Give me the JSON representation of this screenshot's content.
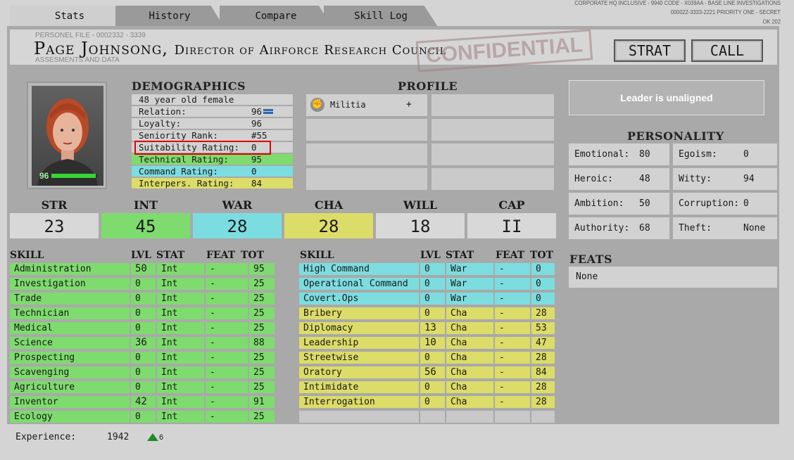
{
  "tabs": [
    "Stats",
    "History",
    "Compare",
    "Skill Log"
  ],
  "header_meta": [
    "CORPORATE HQ INCLUSIVE - 9940 CODE - X039AA - BASE LINE INVESTIGATIONS",
    "000022-3333-2221 PRIORITY ONE - SECRET",
    "OK 202"
  ],
  "personnel_file": "PERSONEL FILE  -  0002332 - 3339",
  "assesments": "ASSESMENTS AND DATA",
  "name": "Page Johnsong,",
  "title": "Director of Airforce Research Council",
  "stamp": "CONFIDENTIAL",
  "buttons": {
    "strat": "STRAT",
    "call": "CALL"
  },
  "portrait": {
    "health": "96",
    "health_fraction": 0.96
  },
  "demographics": {
    "title": "DEMOGRAPHICS",
    "desc": "48 year old female",
    "rows": [
      {
        "label": "Relation:",
        "value": "96"
      },
      {
        "label": "Loyalty:",
        "value": "96"
      },
      {
        "label": "Seniority Rank:",
        "value": "#55"
      },
      {
        "label": "Suitability Rating:",
        "value": "0"
      },
      {
        "label": "Technical Rating:",
        "value": "95"
      },
      {
        "label": "Command Rating:",
        "value": "0"
      },
      {
        "label": "Interpers. Rating:",
        "value": "84"
      }
    ]
  },
  "profile": {
    "title": "PROFILE",
    "item": "Militia",
    "add": "+"
  },
  "alignment": "Leader is unaligned",
  "personality": {
    "title": "PERSONALITY",
    "items": [
      {
        "label": "Emotional:",
        "value": "80"
      },
      {
        "label": "Egoism:",
        "value": "0"
      },
      {
        "label": "Heroic:",
        "value": "48"
      },
      {
        "label": "Witty:",
        "value": "94"
      },
      {
        "label": "Ambition:",
        "value": "50"
      },
      {
        "label": "Corruption:",
        "value": "0"
      },
      {
        "label": "Authority:",
        "value": "68"
      },
      {
        "label": "Theft:",
        "value": "None"
      }
    ]
  },
  "feats": {
    "title": "FEATS",
    "value": "None"
  },
  "stats": [
    {
      "label": "STR",
      "value": "23"
    },
    {
      "label": "INT",
      "value": "45"
    },
    {
      "label": "WAR",
      "value": "28"
    },
    {
      "label": "CHA",
      "value": "28"
    },
    {
      "label": "WILL",
      "value": "18"
    },
    {
      "label": "CAP",
      "value": "II"
    }
  ],
  "skill_headers": [
    "SKILL",
    "LVL",
    "STAT",
    "FEAT",
    "TOT"
  ],
  "skills_left": [
    [
      "Administration",
      "50",
      "Int",
      "-",
      "95"
    ],
    [
      "Investigation",
      "0",
      "Int",
      "-",
      "25"
    ],
    [
      "Trade",
      "0",
      "Int",
      "-",
      "25"
    ],
    [
      "Technician",
      "0",
      "Int",
      "-",
      "25"
    ],
    [
      "Medical",
      "0",
      "Int",
      "-",
      "25"
    ],
    [
      "Science",
      "36",
      "Int",
      "-",
      "88"
    ],
    [
      "Prospecting",
      "0",
      "Int",
      "-",
      "25"
    ],
    [
      "Scavenging",
      "0",
      "Int",
      "-",
      "25"
    ],
    [
      "Agriculture",
      "0",
      "Int",
      "-",
      "25"
    ],
    [
      "Inventor",
      "42",
      "Int",
      "-",
      "91"
    ],
    [
      "Ecology",
      "0",
      "Int",
      "-",
      "25"
    ]
  ],
  "skills_right": [
    [
      "High Command",
      "0",
      "War",
      "-",
      "0"
    ],
    [
      "Operational Command",
      "0",
      "War",
      "-",
      "0"
    ],
    [
      "Covert.Ops",
      "0",
      "War",
      "-",
      "0"
    ],
    [
      "Bribery",
      "0",
      "Cha",
      "-",
      "28"
    ],
    [
      "Diplomacy",
      "13",
      "Cha",
      "-",
      "53"
    ],
    [
      "Leadership",
      "10",
      "Cha",
      "-",
      "47"
    ],
    [
      "Streetwise",
      "0",
      "Cha",
      "-",
      "28"
    ],
    [
      "Oratory",
      "56",
      "Cha",
      "-",
      "84"
    ],
    [
      "Intimidate",
      "0",
      "Cha",
      "-",
      "28"
    ],
    [
      "Interrogation",
      "0",
      "Cha",
      "-",
      "28"
    ]
  ],
  "experience": {
    "label": "Experience:",
    "value": "1942",
    "gain": "6"
  },
  "colors": {
    "green": "#7edb6e",
    "cyan": "#7cdde0",
    "yellow": "#dcdc68",
    "highlight": "#e00000"
  }
}
